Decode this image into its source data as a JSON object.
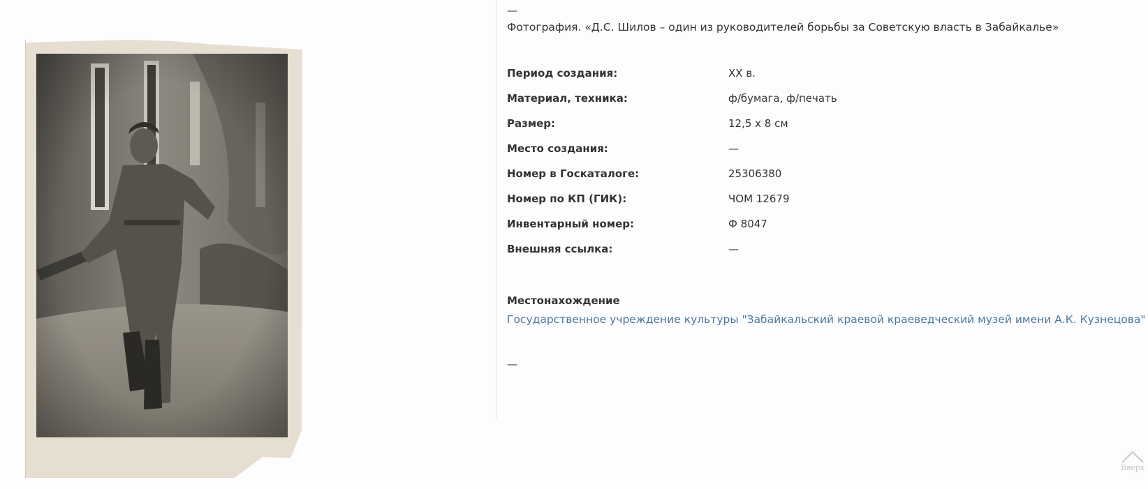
{
  "header": {
    "dash": "—",
    "title": "Фотография. «Д.С. Шилов – один из руководителей борьбы за Советскую власть в Забайкалье»"
  },
  "properties": [
    {
      "label": "Период создания:",
      "value": "XX в."
    },
    {
      "label": "Материал, техника:",
      "value": "ф/бумага, ф/печать"
    },
    {
      "label": "Размер:",
      "value": "12,5 х 8 см"
    },
    {
      "label": "Место создания:",
      "value": "—"
    },
    {
      "label": "Номер в Госкаталоге:",
      "value": "25306380"
    },
    {
      "label": "Номер по КП (ГИК):",
      "value": "ЧОМ 12679"
    },
    {
      "label": "Инвентарный номер:",
      "value": "Ф 8047"
    },
    {
      "label": "Внешняя ссылка:",
      "value": "—"
    }
  ],
  "location": {
    "heading": "Местонахождение",
    "link_text": "Государственное учреждение культуры \"Забайкальский краевой краеведческий музей имени А.К. Кузнецова\""
  },
  "footer": {
    "dash": "—"
  },
  "up_button": {
    "label": "Вверх",
    "icon": "chevron-up-icon"
  },
  "colors": {
    "link": "#4b77a0",
    "text": "#333333",
    "background": "#fdfdfd",
    "photo_paper": "#e8e1d4",
    "photo_sepia": "#6d6a63"
  }
}
